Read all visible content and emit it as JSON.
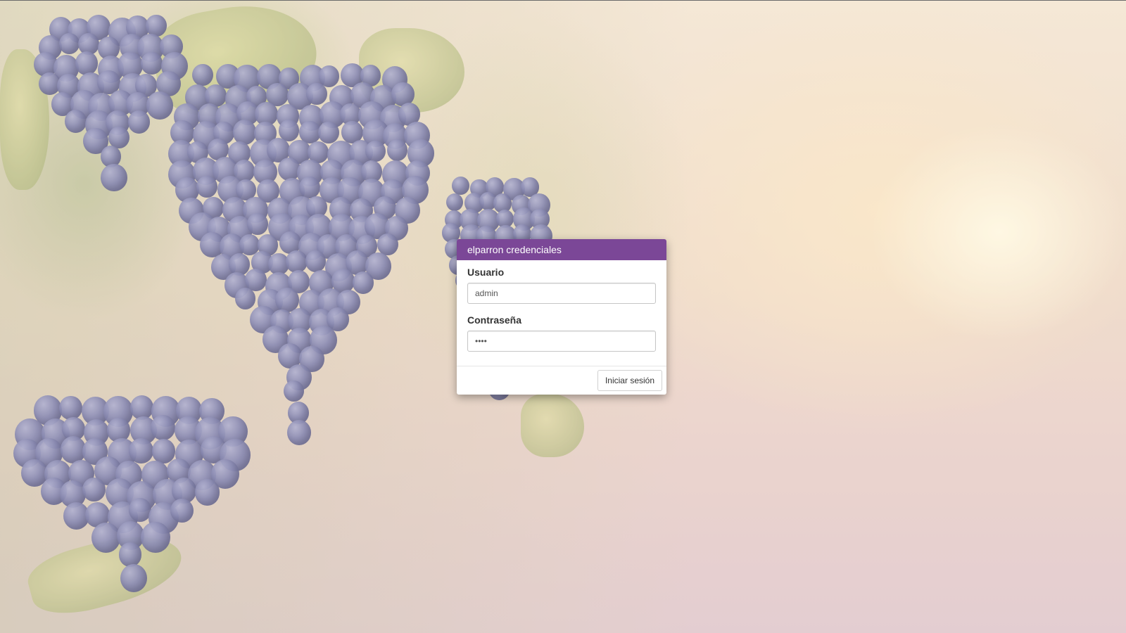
{
  "modal": {
    "title": "elparron credenciales",
    "username_label": "Usuario",
    "username_value": "admin",
    "password_label": "Contraseña",
    "password_value": "••••",
    "submit_label": "Iniciar sesión"
  },
  "colors": {
    "header_purple": "#7b4797"
  }
}
